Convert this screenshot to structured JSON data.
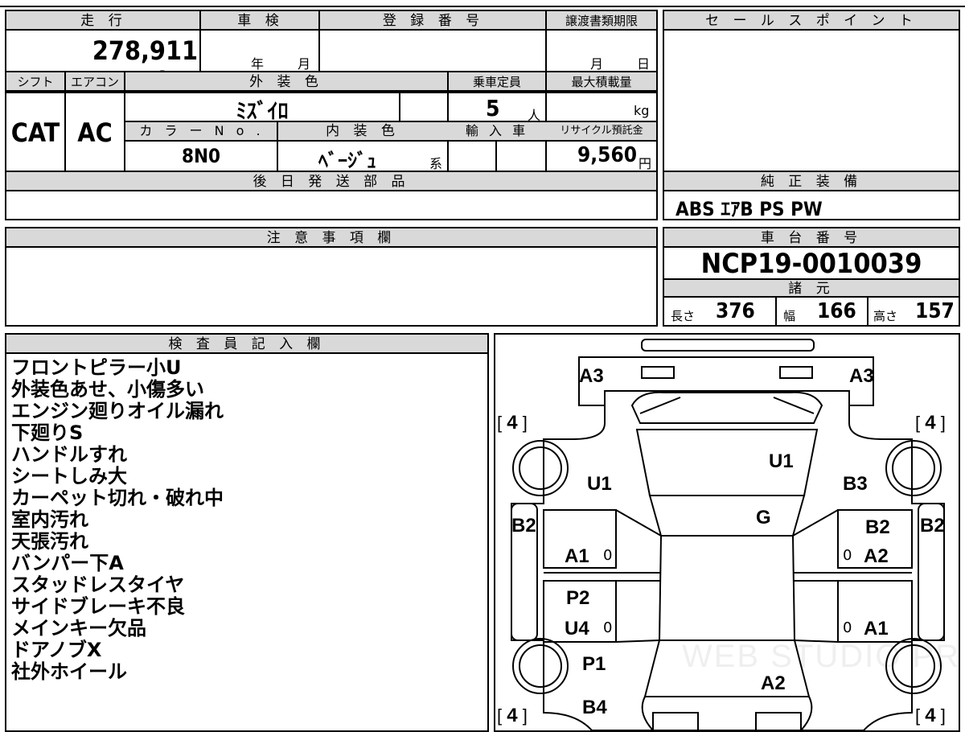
{
  "headers": {
    "mileage": "走 行",
    "inspection": "車 検",
    "registration_no": "登 録 番 号",
    "transfer_deadline": "譲渡書類期限",
    "sales_point": "セ ー ル ス ポ イ ン ト",
    "shift": "シフト",
    "aircon": "エアコン",
    "exterior_color": "外 装 色",
    "capacity": "乗車定員",
    "max_load": "最大積載量",
    "color_no": "カ ラ ー N o .",
    "interior_color": "内 装 色",
    "import": "輸 入 車",
    "recycle_fee": "リサイクル預託金",
    "later_shipping": "後 日 発 送 部 品",
    "genuine_equipment": "純 正 装 備",
    "notes": "注 意 事 項 欄",
    "chassis_no": "車 台 番 号",
    "specs": "諸 元",
    "inspector": "検 査 員 記 入 欄"
  },
  "values": {
    "mileage": "278,911 km",
    "inspection_year_unit": "年",
    "inspection_month_unit": "月",
    "deadline_month_unit": "月",
    "deadline_day_unit": "日",
    "shift": "CAT",
    "aircon": "AC",
    "exterior_color": "ﾐｽﾞｲﾛ",
    "capacity": "5",
    "capacity_unit": "人",
    "load_unit": "kg",
    "color_no": "8N0",
    "interior_color": "ﾍﾞｰｼﾞｭ",
    "interior_suffix": "系",
    "recycle_fee": "9,560",
    "recycle_unit": "円",
    "genuine_equipment": "ABS ｴｱB PS PW",
    "chassis_no": "NCP19-0010039",
    "length_label": "長さ",
    "length": "376",
    "width_label": "幅",
    "width": "166",
    "height_label": "高さ",
    "height": "157"
  },
  "inspector_notes": [
    "フロントピラー小U",
    "外装色あせ、小傷多い",
    "エンジン廻りオイル漏れ",
    "下廻りS",
    "ハンドルすれ",
    "シートしみ大",
    "カーペット切れ・破れ中",
    "室内汚れ",
    "天張汚れ",
    "バンパー下A",
    "スタッドレスタイヤ",
    "サイドブレーキ不良",
    "メインキー欠品",
    "ドアノブX",
    "社外ホイール"
  ],
  "diagram": {
    "labels": {
      "rear_left": "A3",
      "rear_right": "A3",
      "rear_glass": "U1",
      "left_rear_fender": "U1",
      "right_rear_fender": "B3",
      "left_quarter": "B2",
      "right_door_outer": "B2",
      "right_door_inner": "B2",
      "roof": "G",
      "left_rear_door": "A1",
      "right_rear_door": "A2",
      "left_front_door_1": "P2",
      "left_front_door_2": "U4",
      "right_front_door": "A1",
      "left_front_fender": "P1",
      "left_front_bumper": "B4",
      "hood": "A2"
    },
    "zero_marks": [
      "0",
      "0",
      "0",
      "0"
    ],
    "tire_depth": [
      "4",
      "4",
      "4",
      "4"
    ],
    "bracket_open": "[",
    "bracket_close": "]",
    "watermark": "WEB STUDIO PRO"
  }
}
